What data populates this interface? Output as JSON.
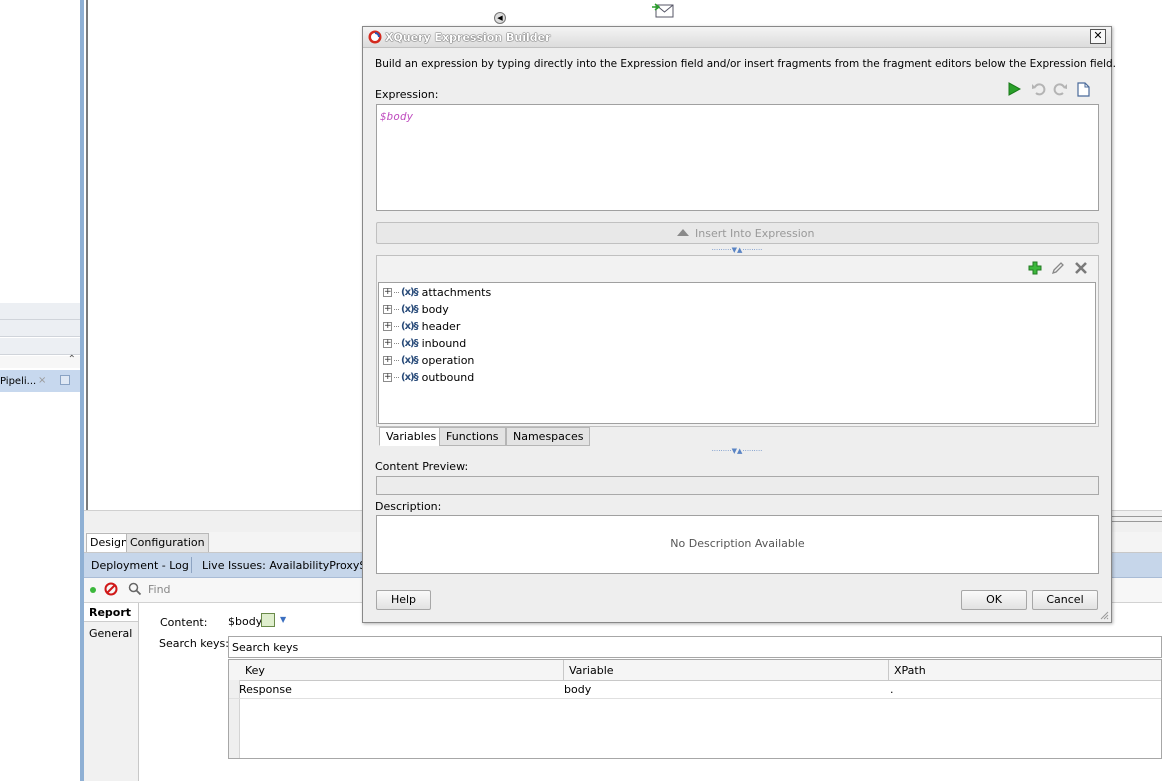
{
  "left_panel": {
    "pipeline_tab_label": "Pipeli...",
    "close_glyph": "×"
  },
  "bottom": {
    "design_tabs": [
      "Design",
      "Configuration"
    ],
    "log_tabs": [
      "Deployment - Log",
      "Live Issues: AvailabilityProxyServ"
    ],
    "find_placeholder": "Find",
    "side_tabs": [
      "Report",
      "General"
    ],
    "content_label": "Content:",
    "content_value": "$body",
    "search_keys_label": "Search keys:",
    "search_keys_placeholder": "Search keys",
    "table": {
      "columns": [
        "Key",
        "Variable",
        "XPath"
      ],
      "rows": [
        [
          "Response",
          "body",
          "."
        ]
      ]
    }
  },
  "dialog": {
    "title": "XQuery Expression Builder",
    "close_glyph": "✕",
    "instruction": "Build an expression by typing directly into the Expression field and/or insert fragments from the fragment editors below the Expression field.",
    "expression_label": "Expression:",
    "expression_value": "$body",
    "insert_button": "Insert Into Expression",
    "variables": [
      "attachments",
      "body",
      "header",
      "inbound",
      "operation",
      "outbound"
    ],
    "tabs": [
      "Variables",
      "Functions",
      "Namespaces"
    ],
    "content_preview_label": "Content Preview:",
    "description_label": "Description:",
    "description_text": "No Description Available",
    "help_button": "Help",
    "ok_button": "OK",
    "cancel_button": "Cancel"
  },
  "colors": {
    "accent": "#c6d6ea",
    "expression_text": "#c04fc0",
    "run_icon": "#2aa02a",
    "add_icon": "#2aa02a"
  }
}
